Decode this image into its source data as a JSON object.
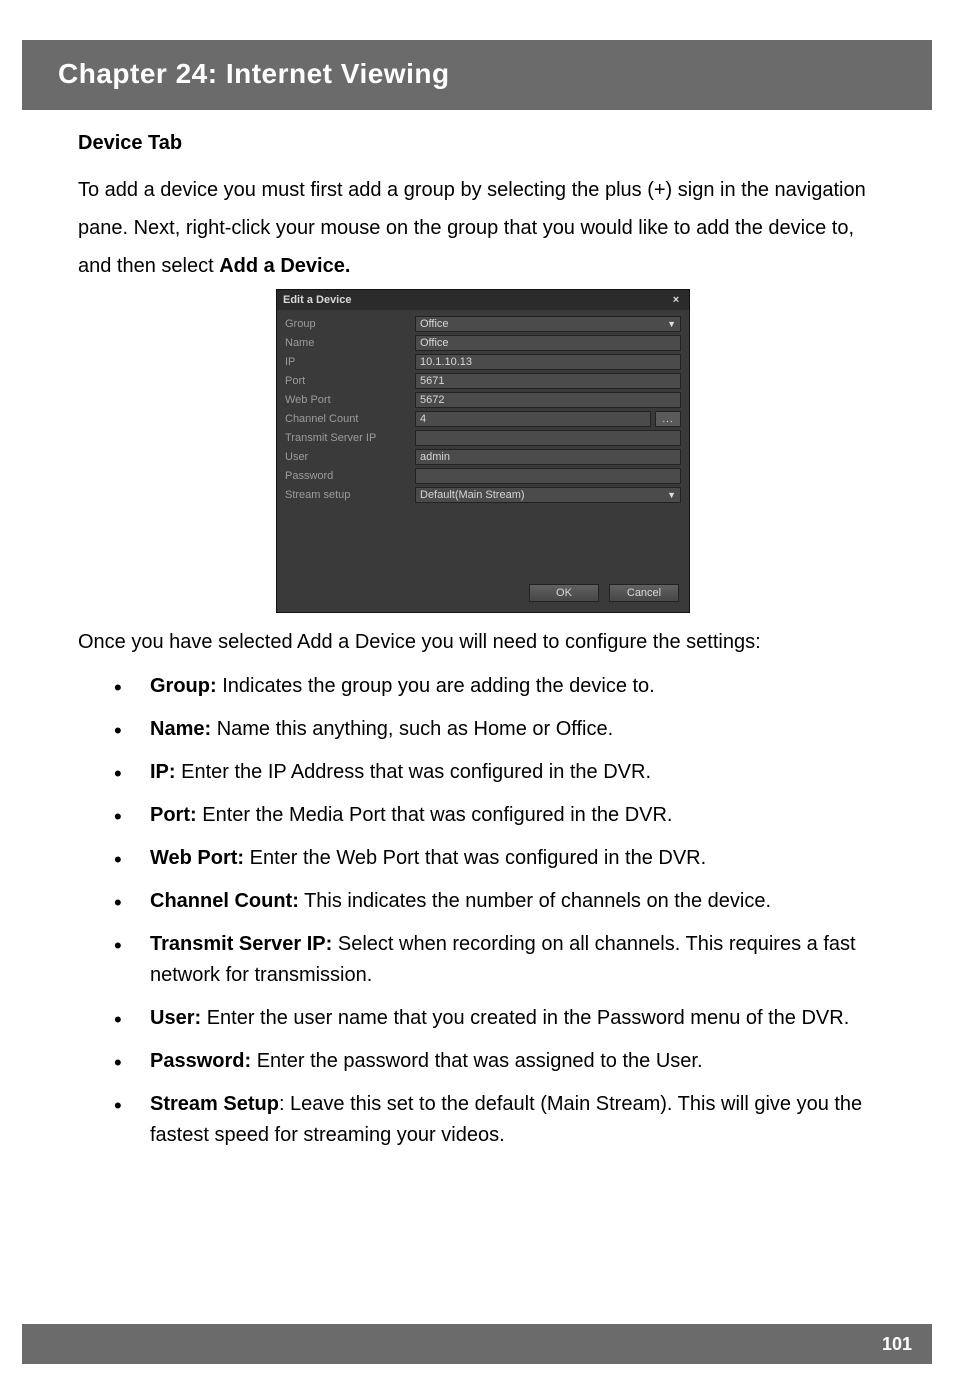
{
  "header": {
    "title": "Chapter 24: Internet Viewing"
  },
  "section": {
    "heading": "Device Tab"
  },
  "paragraphs": {
    "intro_pre": "To add a device you must first add a group by selecting the plus (+) sign in the navigation pane. Next, right-click your mouse on the group that you would like to add the device to, and then select ",
    "intro_bold": "Add a Device.",
    "after_dialog": "Once you have selected Add a Device you will need to configure the settings:"
  },
  "dialog": {
    "title": "Edit a Device",
    "close": "×",
    "rows": {
      "group_label": "Group",
      "group_value": "Office",
      "name_label": "Name",
      "name_value": "Office",
      "ip_label": "IP",
      "ip_value": "10.1.10.13",
      "port_label": "Port",
      "port_value": "5671",
      "webport_label": "Web Port",
      "webport_value": "5672",
      "cc_label": "Channel Count",
      "cc_value": "4",
      "cc_dots": "...",
      "tsip_label": "Transmit Server IP",
      "tsip_value": "",
      "user_label": "User",
      "user_value": "admin",
      "pwd_label": "Password",
      "pwd_value": "",
      "stream_label": "Stream setup",
      "stream_value": "Default(Main Stream)"
    },
    "buttons": {
      "ok": "OK",
      "cancel": "Cancel"
    }
  },
  "bullets": [
    {
      "term": "Group:",
      "text": " Indicates the group you are adding the device to."
    },
    {
      "term": "Name:",
      "text": " Name this anything, such as Home or Office."
    },
    {
      "term": "IP:",
      "text": " Enter the IP Address that was configured in the DVR."
    },
    {
      "term": "Port:",
      "text": " Enter the Media Port that was configured in the DVR."
    },
    {
      "term": "Web Port:",
      "text": " Enter the Web Port that was configured in the DVR."
    },
    {
      "term": "Channel Count:",
      "text": " This indicates the number of channels on the device."
    },
    {
      "term": "Transmit Server IP:",
      "text": " Select when recording on all channels. This requires a fast network for transmission."
    },
    {
      "term": "User:",
      "text": " Enter the user name that you created in the Password menu of the DVR."
    },
    {
      "term": "Password:",
      "text": " Enter the password that was assigned to the User."
    },
    {
      "term": "Stream Setup",
      "text": ": Leave this set to the default (Main Stream). This will give you the fastest speed for streaming your videos."
    }
  ],
  "footer": {
    "page_number": "101"
  }
}
